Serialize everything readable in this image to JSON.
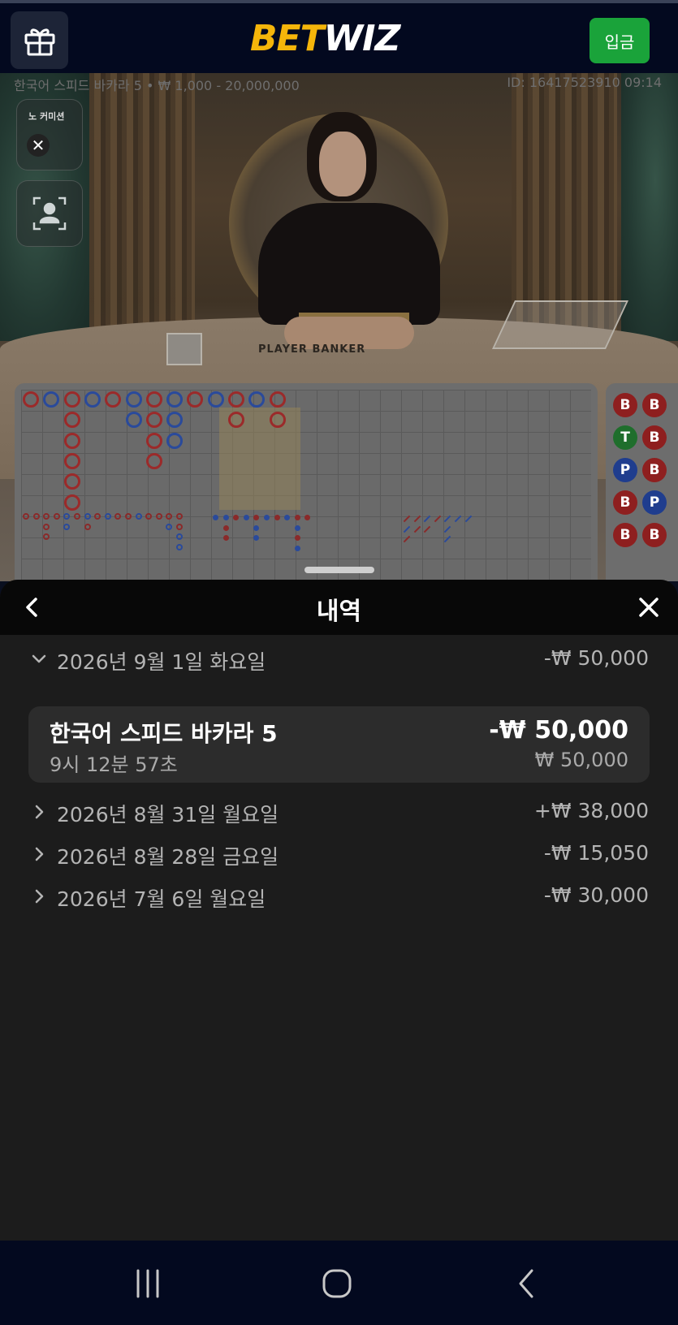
{
  "header": {
    "logo_part1": "BET",
    "logo_part2": "WIZ",
    "deposit_label": "입금"
  },
  "game": {
    "info": "한국어 스피드 바카라 5 • ₩ 1,000 - 20,000,000",
    "id": "ID: 16417523910 09:14",
    "no_commission_label": "노 커미션",
    "table_text": "PLAYER   BANKER"
  },
  "bead_plate": {
    "col1": [
      "B",
      "T",
      "P",
      "B",
      "B"
    ],
    "col2": [
      "B",
      "B",
      "B",
      "P",
      "B"
    ]
  },
  "history": {
    "title": "내역",
    "days": [
      {
        "label": "2026년 9월 1일 화요일",
        "amount": "-₩ 50,000",
        "expanded": true
      },
      {
        "label": "2026년 8월 31일 월요일",
        "amount": "+₩ 38,000",
        "expanded": false
      },
      {
        "label": "2026년 8월 28일 금요일",
        "amount": "-₩ 15,050",
        "expanded": false
      },
      {
        "label": "2026년 7월 6일 월요일",
        "amount": "-₩ 30,000",
        "expanded": false
      }
    ],
    "bet": {
      "name": "한국어 스피드 바카라 5",
      "time": "9시 12분 57초",
      "amount": "-₩ 50,000",
      "stake": "₩ 50,000"
    }
  },
  "icons": {
    "gift": "gift-icon",
    "back": "chevron-left-icon",
    "close": "close-icon",
    "expand": "chevron-down-icon",
    "collapsed": "chevron-right-icon"
  },
  "colors": {
    "deposit": "#1aa33a",
    "logo_accent": "#f5b50a",
    "banker": "#8e1f1f",
    "player": "#1f3d8e",
    "tie": "#1f6e2c"
  }
}
